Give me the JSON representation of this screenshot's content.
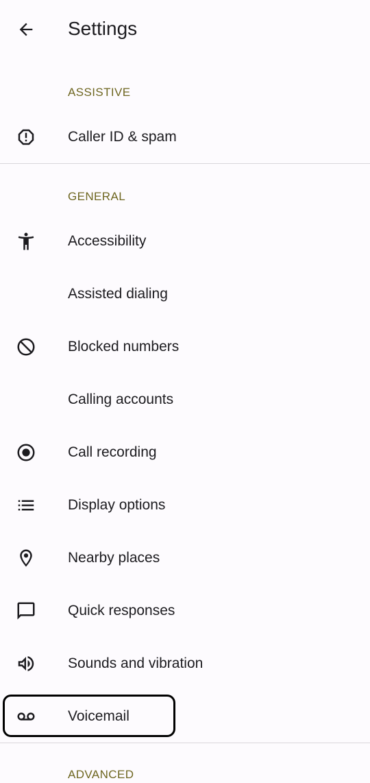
{
  "header": {
    "title": "Settings",
    "back_icon": "arrow-back-icon"
  },
  "sections": {
    "assistive": "ASSISTIVE",
    "general": "GENERAL",
    "advanced": "ADVANCED"
  },
  "items": {
    "caller_id": {
      "label": "Caller ID & spam",
      "icon": "report-icon"
    },
    "accessibility": {
      "label": "Accessibility",
      "icon": "accessibility-icon"
    },
    "assisted_dialing": {
      "label": "Assisted dialing"
    },
    "blocked_numbers": {
      "label": "Blocked numbers",
      "icon": "block-icon"
    },
    "calling_accounts": {
      "label": "Calling accounts"
    },
    "call_recording": {
      "label": "Call recording",
      "icon": "record-icon"
    },
    "display_options": {
      "label": "Display options",
      "icon": "list-icon"
    },
    "nearby_places": {
      "label": "Nearby places",
      "icon": "location-pin-icon"
    },
    "quick_responses": {
      "label": "Quick responses",
      "icon": "chat-bubble-icon"
    },
    "sounds_vibration": {
      "label": "Sounds and vibration",
      "icon": "volume-icon"
    },
    "voicemail": {
      "label": "Voicemail",
      "icon": "voicemail-icon",
      "focused": true
    }
  },
  "colors": {
    "background": "#fdfbfe",
    "section_header": "#6e6620",
    "text": "#1c1b1f",
    "divider": "#d9d6dc"
  }
}
